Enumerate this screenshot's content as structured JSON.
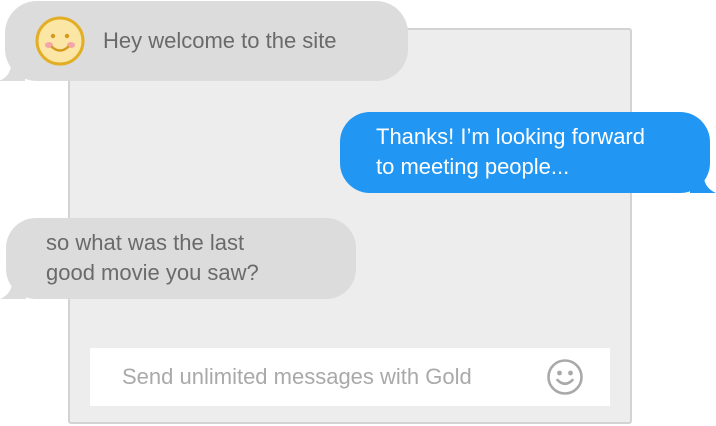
{
  "chat": {
    "messages": [
      {
        "direction": "incoming",
        "avatar_icon": "smiley-face-icon",
        "lines": [
          "Hey welcome to the site"
        ]
      },
      {
        "direction": "outgoing",
        "lines": [
          "Thanks! I’m looking forward",
          "to meeting people..."
        ]
      },
      {
        "direction": "incoming",
        "lines": [
          "so what was the last",
          "good movie you saw?"
        ]
      }
    ]
  },
  "composer": {
    "placeholder": "Send unlimited messages with Gold",
    "emoji_icon": "smiley-icon"
  },
  "colors": {
    "incoming_bubble": "#dcdcdc",
    "incoming_text": "#6a6a6a",
    "outgoing_bubble": "#2196f3",
    "outgoing_text": "#ffffff",
    "panel": "#ededed",
    "avatar": "#f3c544"
  }
}
